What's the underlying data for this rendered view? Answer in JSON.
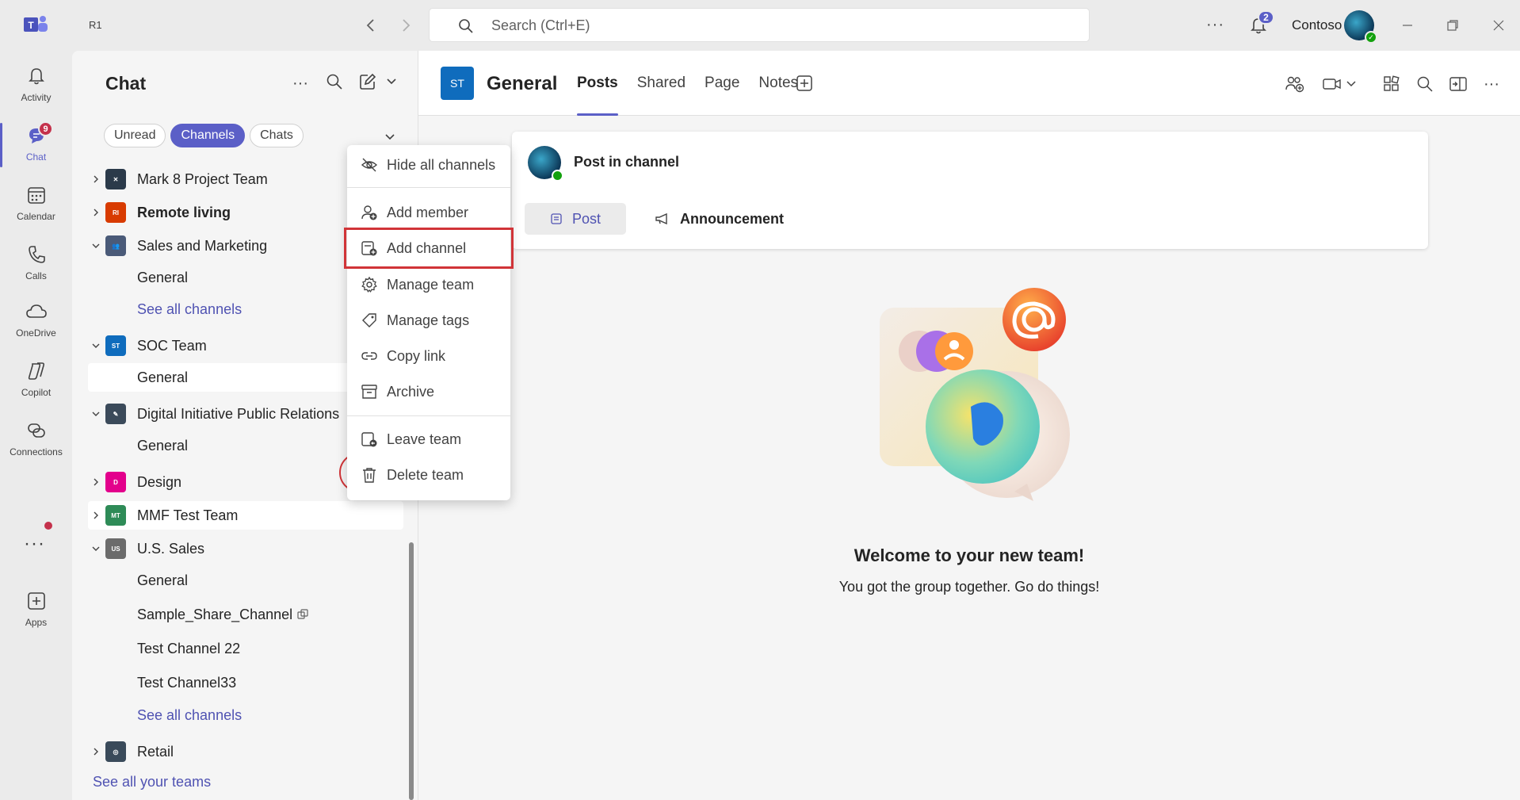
{
  "titlebar": {
    "workspace": "R1",
    "search_placeholder": "Search (Ctrl+E)",
    "notification_count": "2",
    "org_name": "Contoso"
  },
  "rail": {
    "items": [
      {
        "label": "Activity",
        "icon": "bell-icon"
      },
      {
        "label": "Chat",
        "icon": "chat-icon",
        "badge": "9"
      },
      {
        "label": "Calendar",
        "icon": "calendar-icon"
      },
      {
        "label": "Calls",
        "icon": "phone-icon"
      },
      {
        "label": "OneDrive",
        "icon": "cloud-icon"
      },
      {
        "label": "Copilot",
        "icon": "copilot-icon"
      },
      {
        "label": "Connections",
        "icon": "connections-icon"
      },
      {
        "label": "Apps",
        "icon": "apps-icon"
      }
    ]
  },
  "leftpane": {
    "title": "Chat",
    "filters": [
      "Unread",
      "Channels",
      "Chats"
    ],
    "active_filter": "Channels",
    "teams": [
      {
        "name": "Mark 8 Project Team",
        "initials": "",
        "color": "#2b3a4a"
      },
      {
        "name": "Remote living",
        "initials": "RI",
        "color": "#d83b01"
      },
      {
        "name": "Sales and Marketing",
        "initials": "",
        "color": "#4a5a78"
      },
      {
        "name": "SOC Team",
        "initials": "ST",
        "color": "#0f6cbd"
      },
      {
        "name": "Digital Initiative Public Relations",
        "initials": "",
        "color": "#3b4a5a"
      },
      {
        "name": "Design",
        "initials": "D",
        "color": "#e3008c"
      },
      {
        "name": "MMF Test Team",
        "initials": "MT",
        "color": "#2e8b57"
      },
      {
        "name": "U.S. Sales",
        "initials": "US",
        "color": "#6b6b6b"
      },
      {
        "name": "Retail",
        "initials": "",
        "color": "#3a4a5a"
      }
    ],
    "channels": {
      "sales_general": "General",
      "sales_see_all": "See all channels",
      "soc_general": "General",
      "digital_general": "General",
      "us_general": "General",
      "us_shared": "Sample_Share_Channel",
      "us_test22": "Test Channel 22",
      "us_test33": "Test Channel33",
      "us_see_all": "See all channels"
    },
    "see_all_teams": "See all your teams"
  },
  "context_menu": {
    "items": [
      {
        "label": "Hide all channels",
        "icon": "eye-off-icon"
      },
      {
        "label": "Add member",
        "icon": "person-add-icon"
      },
      {
        "label": "Add channel",
        "icon": "channel-add-icon"
      },
      {
        "label": "Manage team",
        "icon": "gear-icon"
      },
      {
        "label": "Manage tags",
        "icon": "tag-icon"
      },
      {
        "label": "Copy link",
        "icon": "link-icon"
      },
      {
        "label": "Archive",
        "icon": "archive-icon"
      },
      {
        "label": "Leave team",
        "icon": "leave-icon"
      },
      {
        "label": "Delete team",
        "icon": "trash-icon"
      }
    ]
  },
  "main": {
    "avatar_initials": "ST",
    "title": "General",
    "tabs": [
      "Posts",
      "Shared",
      "Page",
      "Notes"
    ],
    "active_tab": "Posts",
    "post_prompt": "Post in channel",
    "post_button": "Post",
    "announcement_button": "Announcement",
    "welcome_title": "Welcome to your new team!",
    "welcome_sub": "You got the group together. Go do things!"
  },
  "colors": {
    "accent": "#5b5fc7",
    "highlight": "#d13438"
  }
}
